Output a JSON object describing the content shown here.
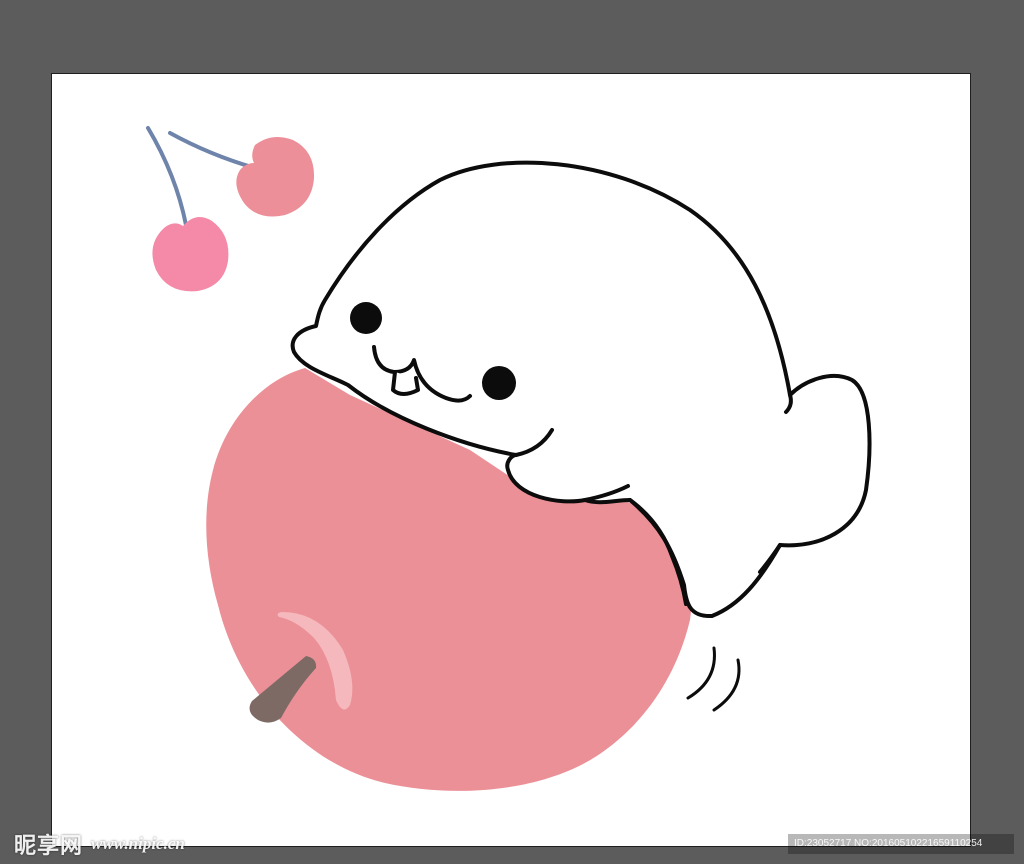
{
  "watermark": {
    "logo_text": "昵享网",
    "site_text": "www.nipic.cn"
  },
  "image_id": {
    "text": "ID:23052717 NO:20160510221659110254"
  },
  "colors": {
    "workspace_bg": "#5c5c5c",
    "artboard_bg": "#ffffff",
    "apple": "#ec9098",
    "apple_highlight": "#f5b9bd",
    "apple_stem": "#7d6a64",
    "cherry_right": "#ec8f98",
    "cherry_left": "#f48aa8",
    "cherry_stem": "#6f84aa",
    "outline": "#0c0c0c"
  },
  "icons": {
    "cherries": "cherries-icon",
    "apple": "apple-icon",
    "seal": "seal-character-icon"
  }
}
